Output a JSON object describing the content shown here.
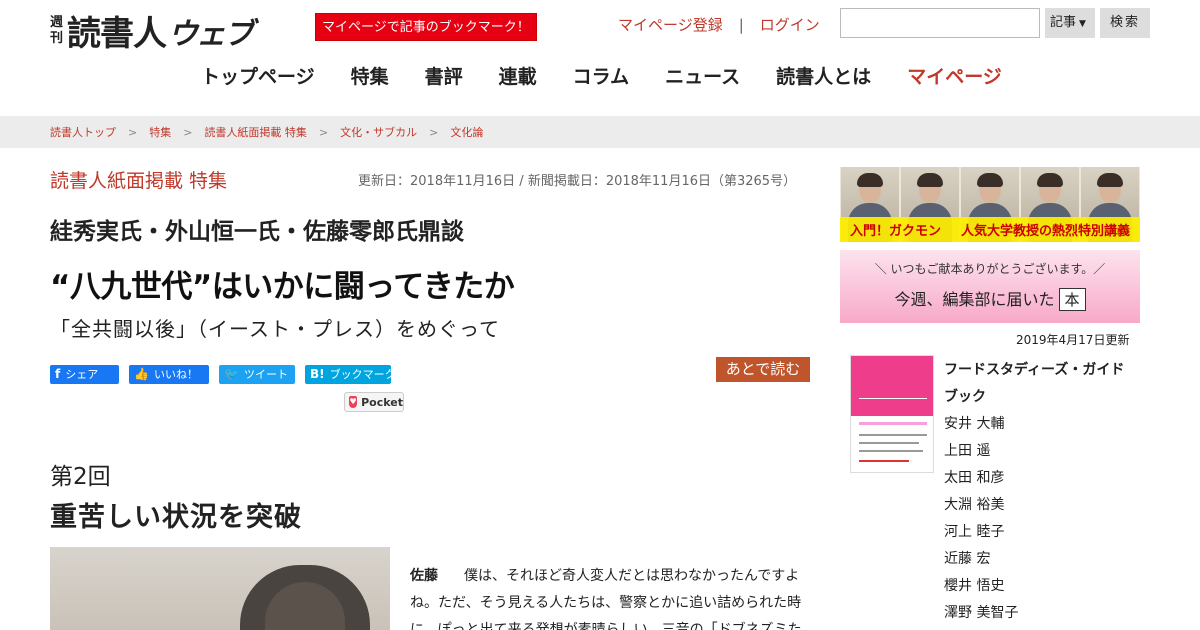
{
  "header": {
    "logo_small_1": "週",
    "logo_small_2": "刊",
    "logo_main": "読書人",
    "logo_web": "ウェブ",
    "promo": "マイページで記事のブックマーク！",
    "mypage_register": "マイページ登録",
    "separator": "|",
    "login": "ログイン",
    "search_value": "",
    "search_select": "記事",
    "search_select_caret": "▼",
    "search_button": "検索"
  },
  "nav": [
    {
      "label": "トップページ",
      "active": false
    },
    {
      "label": "特集",
      "active": false
    },
    {
      "label": "書評",
      "active": false
    },
    {
      "label": "連載",
      "active": false
    },
    {
      "label": "コラム",
      "active": false
    },
    {
      "label": "ニュース",
      "active": false
    },
    {
      "label": "読書人とは",
      "active": false
    },
    {
      "label": "マイページ",
      "active": true
    }
  ],
  "breadcrumb": [
    "読書人トップ",
    "特集",
    "読書人紙面掲載 特集",
    "文化・サブカル",
    "文化論"
  ],
  "breadcrumb_chevron": "＞",
  "article": {
    "section": "読書人紙面掲載 特集",
    "dates": "更新日：2018年11月16日 / 新聞掲載日：2018年11月16日（第3265号）",
    "subtitle": "絓秀実氏・外山恒一氏・佐藤零郎氏鼎談",
    "title": "“八九世代”はいかに闘ってきたか",
    "lead": "「全共闘以後」（イースト・プレス）をめぐって",
    "share": {
      "facebook": "シェア",
      "facebook_icon": "f",
      "like": "いいね！",
      "like_icon": "👍",
      "tweet": "ツイート",
      "tweet_icon": "🐦",
      "hatena": "ブックマーク",
      "hatena_icon": "B!",
      "pocket": "Pocket",
      "pocket_icon": "♥"
    },
    "read_later": "あとで読む",
    "chapter": "第2回",
    "chapter_title": "重苦しい状況を突破",
    "speaker": "佐藤",
    "body": "僕は、それほど奇人変人だとは思わなかったんですよね。ただ、そう見える人たちは、警察とかに追い詰められた時に、ぽっと出て来る発想が素晴らしい。三音の「ドブネズミた"
  },
  "sidebar": {
    "banner1_caption_left": "入門！ガクモン",
    "banner1_caption_right": "人気大学教授の熱烈特別講義",
    "banner2_top": "＼ いつもご献本ありがとうございます。／",
    "banner2_main": "今週、編集部に届いた",
    "banner2_hon": "本",
    "updated": "2019年4月17日更新",
    "book_title": "フードスタディーズ・ガイドブック",
    "authors": [
      "安井 大輔",
      "上田 遥",
      "太田 和彦",
      "大淵 裕美",
      "河上 睦子",
      "近藤 宏",
      "櫻井 悟史",
      "澤野 美智子"
    ]
  }
}
